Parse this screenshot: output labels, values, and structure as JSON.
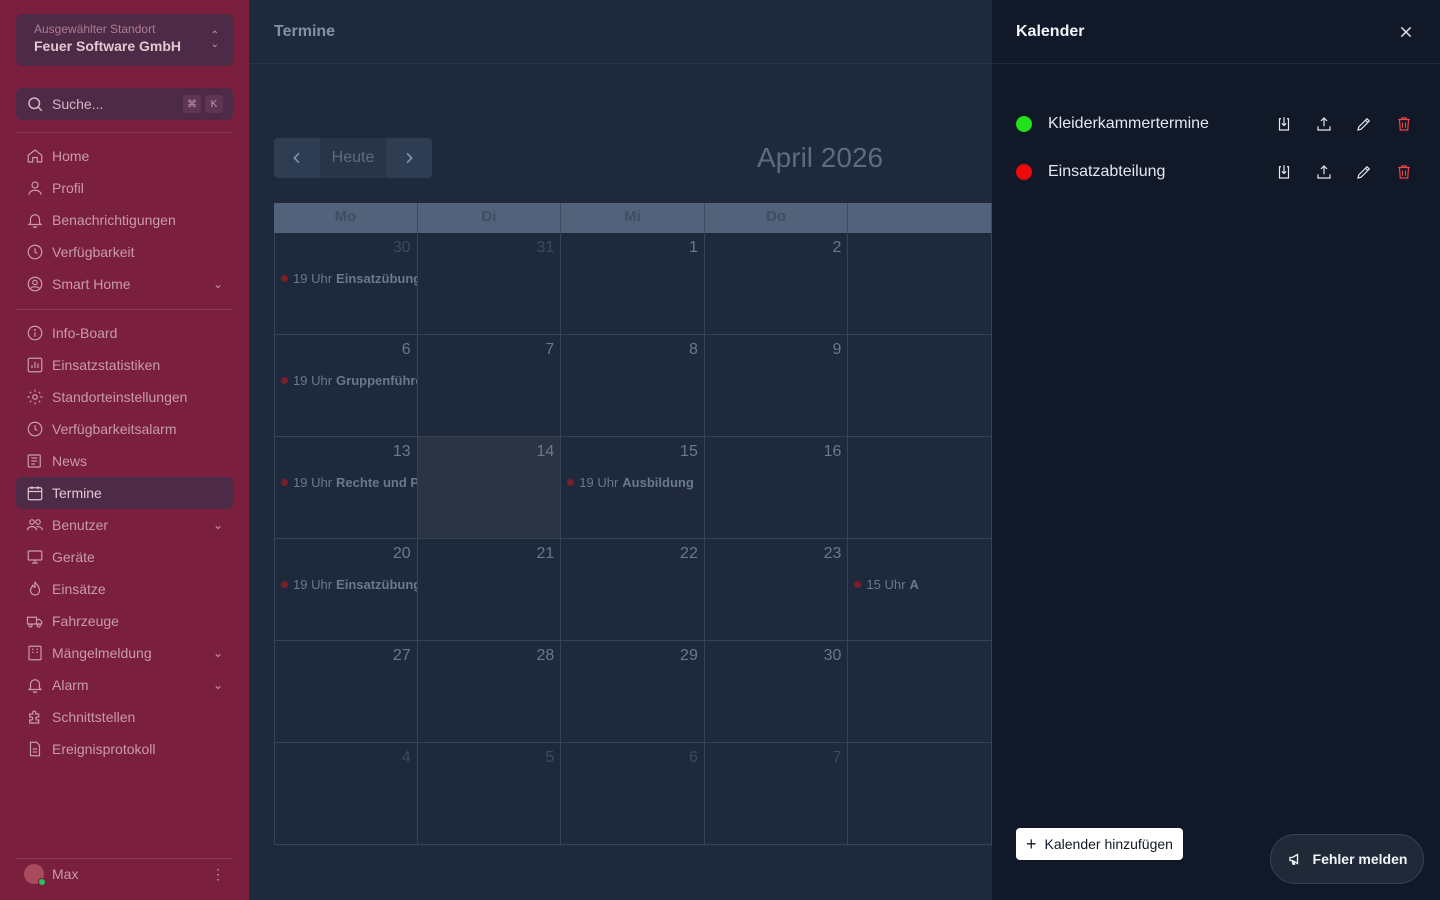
{
  "sidebar": {
    "location_label": "Ausgewählter Standort",
    "location_name": "Feuer Software GmbH",
    "search_placeholder": "Suche...",
    "shortcut_keys": [
      "⌘",
      "K"
    ],
    "nav_group1": [
      {
        "label": "Home",
        "icon": "home-icon"
      },
      {
        "label": "Profil",
        "icon": "user-icon"
      },
      {
        "label": "Benachrichtigungen",
        "icon": "bell-icon"
      },
      {
        "label": "Verfügbarkeit",
        "icon": "clock-icon"
      },
      {
        "label": "Smart Home",
        "icon": "user-circle-icon",
        "expandable": true
      }
    ],
    "nav_group2": [
      {
        "label": "Info-Board",
        "icon": "info-icon"
      },
      {
        "label": "Einsatzstatistiken",
        "icon": "chart-icon"
      },
      {
        "label": "Standorteinstellungen",
        "icon": "gear-icon"
      },
      {
        "label": "Verfügbarkeitsalarm",
        "icon": "clock-icon"
      },
      {
        "label": "News",
        "icon": "newspaper-icon"
      },
      {
        "label": "Termine",
        "icon": "calendar-icon",
        "active": true
      },
      {
        "label": "Benutzer",
        "icon": "users-icon",
        "expandable": true
      },
      {
        "label": "Geräte",
        "icon": "monitor-icon"
      },
      {
        "label": "Einsätze",
        "icon": "fire-icon"
      },
      {
        "label": "Fahrzeuge",
        "icon": "truck-icon"
      },
      {
        "label": "Mängelmeldung",
        "icon": "building-icon",
        "expandable": true
      },
      {
        "label": "Alarm",
        "icon": "bell-icon",
        "expandable": true
      },
      {
        "label": "Schnittstellen",
        "icon": "puzzle-icon"
      },
      {
        "label": "Ereignisprotokoll",
        "icon": "document-icon"
      }
    ],
    "user_name": "Max"
  },
  "main": {
    "title": "Termine",
    "today_label": "Heute",
    "month_label": "April 2026",
    "weekdays": [
      "Mo",
      "Di",
      "Mi",
      "Do",
      ""
    ],
    "weeks": [
      [
        {
          "n": "30",
          "muted": true,
          "event": {
            "time": "19 Uhr",
            "title": "Einsatzübung E"
          }
        },
        {
          "n": "31",
          "muted": true
        },
        {
          "n": "1"
        },
        {
          "n": "2"
        },
        {
          "n": ""
        }
      ],
      [
        {
          "n": "6",
          "event": {
            "time": "19 Uhr",
            "title": "Gruppenführer"
          }
        },
        {
          "n": "7"
        },
        {
          "n": "8"
        },
        {
          "n": "9"
        },
        {
          "n": ""
        }
      ],
      [
        {
          "n": "13",
          "event": {
            "time": "19 Uhr",
            "title": "Rechte und Pfli"
          }
        },
        {
          "n": "14",
          "today": true
        },
        {
          "n": "15",
          "event": {
            "time": "19 Uhr",
            "title": "Ausbildung"
          }
        },
        {
          "n": "16"
        },
        {
          "n": ""
        }
      ],
      [
        {
          "n": "20",
          "event": {
            "time": "19 Uhr",
            "title": "Einsatzübung"
          }
        },
        {
          "n": "21"
        },
        {
          "n": "22"
        },
        {
          "n": "23"
        },
        {
          "n": "",
          "event": {
            "time": "15 Uhr",
            "title": "A"
          }
        }
      ],
      [
        {
          "n": "27"
        },
        {
          "n": "28"
        },
        {
          "n": "29"
        },
        {
          "n": "30"
        },
        {
          "n": ""
        }
      ],
      [
        {
          "n": "4",
          "muted": true
        },
        {
          "n": "5",
          "muted": true
        },
        {
          "n": "6",
          "muted": true
        },
        {
          "n": "7",
          "muted": true
        },
        {
          "n": ""
        }
      ]
    ]
  },
  "drawer": {
    "title": "Kalender",
    "calendars": [
      {
        "name": "Kleiderkammertermine",
        "color": "#22e01a"
      },
      {
        "name": "Einsatzabteilung",
        "color": "#ef0a0a"
      }
    ],
    "add_label": "Kalender hinzufügen"
  },
  "report_label": "Fehler melden"
}
